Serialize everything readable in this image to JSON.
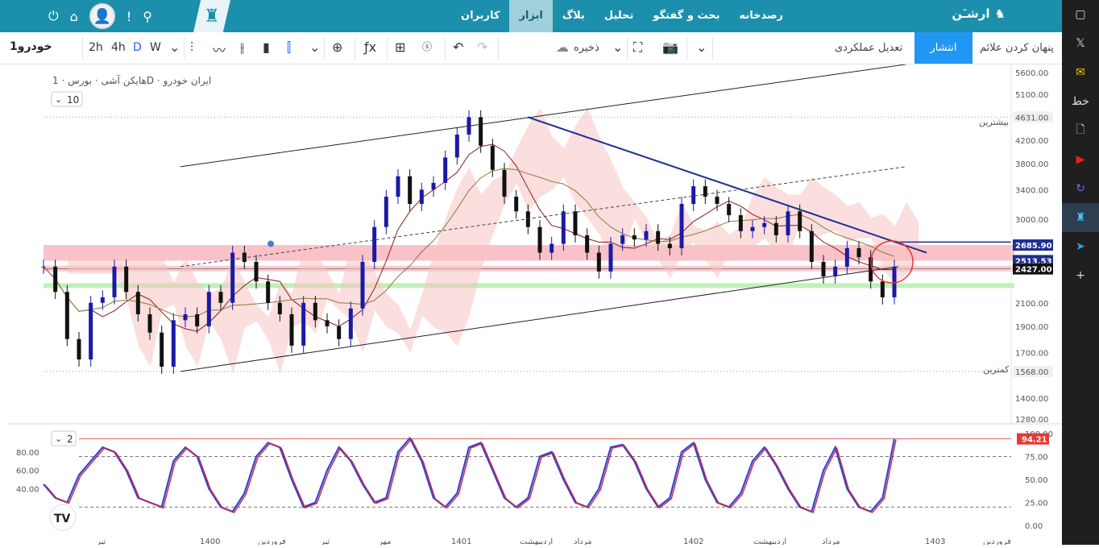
{
  "nav": {
    "brand": "ارشـَن",
    "menu": [
      "رصدخانه",
      "بحث و گفتگو",
      "تحلیل",
      "بلاگ",
      "ابزار",
      "کاربران"
    ],
    "active_menu": "ابزار",
    "icons": [
      "power-icon",
      "home-icon",
      "avatar",
      "alert-icon",
      "search-icon"
    ]
  },
  "toolbar": {
    "symbol": "خودرو1",
    "timeframes": [
      "2h",
      "4h",
      "D",
      "W"
    ],
    "active_tf": "D",
    "save_label": "ذخیره",
    "perf_label": "تعدیل عملکردی",
    "publish_label": "انتشار",
    "hide_label": "پنهان کردن علائم"
  },
  "legend": {
    "title": "هایکن آشی · بورس · 1D · ایران خودرو",
    "price_scale_value": "10",
    "osc_scale_value": "2"
  },
  "price_axis": [
    "5600.00",
    "5100.00",
    "4631.00",
    "4200.00",
    "3800.00",
    "3400.00",
    "3000.00",
    "2685.90",
    "2513.53",
    "2427.00",
    "2100.00",
    "1900.00",
    "1700.00",
    "1568.00",
    "1400.00",
    "1280.00"
  ],
  "labels": {
    "high": "بیشترین",
    "low": "کمترین"
  },
  "osc_axis_right": [
    "100.00",
    "75.00",
    "50.00",
    "25.00",
    "0.00"
  ],
  "osc_axis_left": [
    "80.00",
    "60.00",
    "40.00"
  ],
  "osc_value": "94.21",
  "time_axis": [
    "تیر",
    "1400",
    "فروردین",
    "تیر",
    "مهر",
    "1401",
    "اردیبهشت",
    "مرداد",
    "1402",
    "اردیبهشت",
    "مرداد",
    "1403",
    "فروردین"
  ],
  "chart_data": {
    "type": "line",
    "title": "هایکن آشی · بورس · 1D · ایران خودرو",
    "ylim": [
      1280,
      5600
    ],
    "log_scale": true,
    "series": [
      {
        "values": [
          2450,
          2200,
          1800,
          1650,
          2100,
          2150,
          2450,
          2200,
          2000,
          1850,
          1600,
          1950,
          2000,
          1900,
          2200,
          2100,
          2600,
          2500,
          2300,
          2100,
          2000,
          1750,
          2100,
          1950,
          1900,
          1800,
          2050,
          2500,
          2900,
          3300,
          3600,
          3200,
          3400,
          3500,
          3900,
          4300,
          4631,
          4100,
          3700,
          3300,
          3100,
          2900,
          2600,
          2700,
          3100,
          2800,
          2600,
          2400,
          2700,
          2800,
          2750,
          2850,
          2700,
          2650,
          3200,
          3450,
          3300,
          3200,
          3050,
          2850,
          2900,
          2950,
          2800,
          3100,
          2850,
          2500,
          2350,
          2450,
          2650,
          2550,
          2300,
          2150,
          2450
        ]
      }
    ],
    "lines": {
      "upper_channel_start": 3750,
      "upper_channel_end": 5800,
      "lower_channel_start": 1568,
      "resistance_trend_start": 4631,
      "resistance_trend_end": 2600,
      "resistance_zone": [
        2513.53,
        2685.9
      ],
      "support_zone": 2260,
      "level_2427": 2427
    },
    "oscillator": {
      "ylim": [
        0,
        100
      ],
      "levels": [
        75,
        20
      ],
      "last": 94.21,
      "values": [
        45,
        30,
        25,
        55,
        70,
        85,
        80,
        60,
        30,
        25,
        20,
        70,
        85,
        75,
        40,
        20,
        15,
        35,
        75,
        90,
        85,
        50,
        20,
        25,
        60,
        85,
        70,
        45,
        25,
        30,
        80,
        95,
        70,
        30,
        20,
        35,
        85,
        90,
        60,
        30,
        20,
        30,
        75,
        80,
        50,
        25,
        20,
        40,
        85,
        88,
        70,
        40,
        20,
        30,
        80,
        90,
        50,
        25,
        20,
        35,
        70,
        85,
        65,
        40,
        20,
        15,
        60,
        85,
        40,
        20,
        15,
        30,
        94.21
      ]
    }
  }
}
